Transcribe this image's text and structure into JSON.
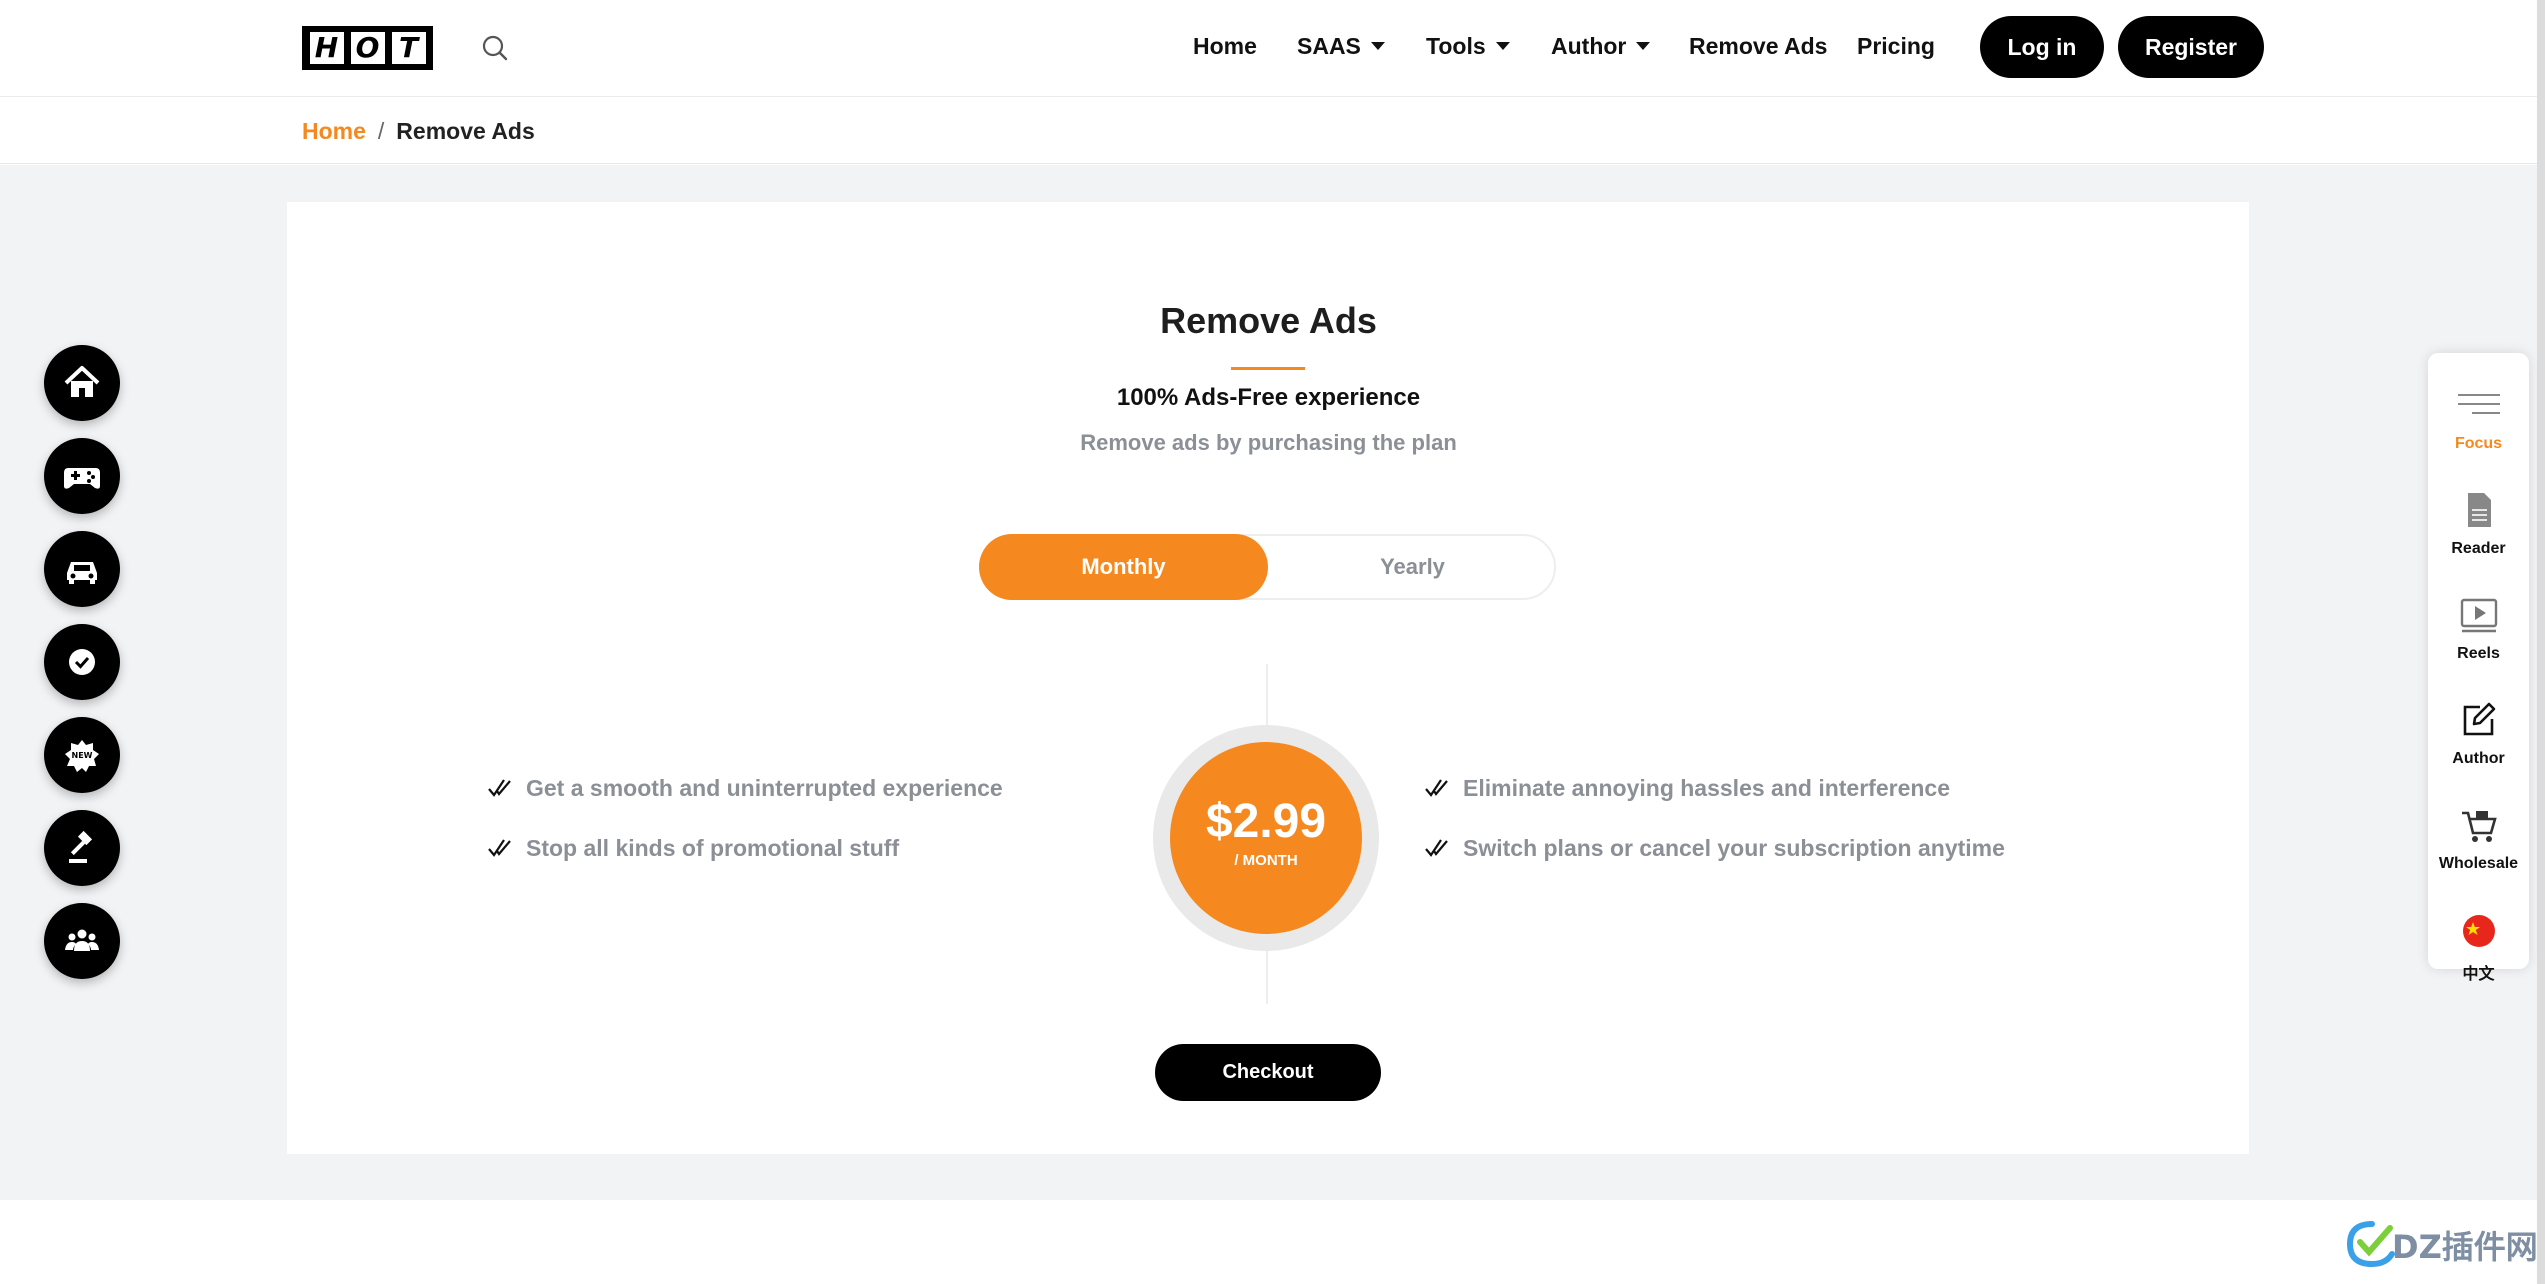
{
  "header": {
    "logo_letters": [
      "H",
      "O",
      "T"
    ],
    "nav": [
      {
        "label": "Home",
        "dropdown": false
      },
      {
        "label": "SAAS",
        "dropdown": true
      },
      {
        "label": "Tools",
        "dropdown": true
      },
      {
        "label": "Author",
        "dropdown": true
      },
      {
        "label": "Remove Ads",
        "dropdown": false
      },
      {
        "label": "Pricing",
        "dropdown": false
      }
    ],
    "login_label": "Log in",
    "register_label": "Register"
  },
  "breadcrumb": {
    "home": "Home",
    "separator": "/",
    "current": "Remove Ads"
  },
  "main": {
    "title": "Remove Ads",
    "subtitle": "100% Ads-Free experience",
    "description": "Remove ads by purchasing the plan",
    "toggle": {
      "monthly": "Monthly",
      "yearly": "Yearly",
      "selected": "Monthly"
    },
    "price": {
      "amount": "$2.99",
      "period": "/ MONTH"
    },
    "features_left": [
      "Get a smooth and uninterrupted experience",
      "Stop all kinds of promotional stuff"
    ],
    "features_right": [
      "Eliminate annoying hassles and interference",
      "Switch plans or cancel your subscription anytime"
    ],
    "checkout_label": "Checkout"
  },
  "left_floating": [
    "home-icon",
    "gamepad-icon",
    "car-icon",
    "verified-badge-icon",
    "new-badge-icon",
    "gavel-icon",
    "community-icon"
  ],
  "right_panel": [
    {
      "label": "Focus",
      "icon": "menu-lines-icon",
      "active": true
    },
    {
      "label": "Reader",
      "icon": "document-icon",
      "active": false
    },
    {
      "label": "Reels",
      "icon": "video-play-icon",
      "active": false
    },
    {
      "label": "Author",
      "icon": "edit-icon",
      "active": false
    },
    {
      "label": "Wholesale",
      "icon": "cart-icon",
      "active": false
    },
    {
      "label": "中文",
      "icon": "china-flag-icon",
      "active": false
    }
  ],
  "colors": {
    "accent": "#f5891f",
    "dark": "#000000",
    "muted": "#8b8f96",
    "background": "#f2f3f5"
  },
  "watermark": "DZ插件网"
}
